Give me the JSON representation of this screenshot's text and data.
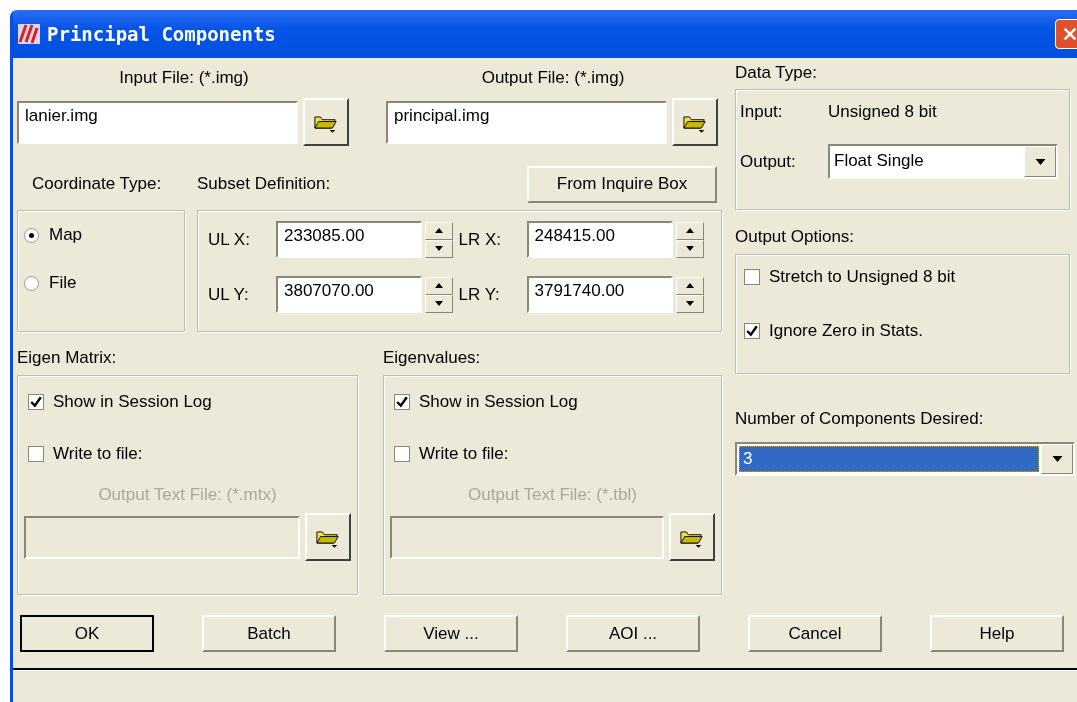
{
  "window": {
    "title": "Principal Components"
  },
  "input_file": {
    "label": "Input File: (*.img)",
    "value": "lanier.img"
  },
  "output_file": {
    "label": "Output File: (*.img)",
    "value": "principal.img"
  },
  "coordinate_type": {
    "label": "Coordinate Type:",
    "options": [
      {
        "label": "Map",
        "selected": true
      },
      {
        "label": "File",
        "selected": false
      }
    ]
  },
  "subset_definition": {
    "label": "Subset Definition:",
    "button": "From Inquire Box",
    "fields": [
      {
        "label": "UL X:",
        "value": "233085.00"
      },
      {
        "label": "LR X:",
        "value": "248415.00"
      },
      {
        "label": "UL Y:",
        "value": "3807070.00"
      },
      {
        "label": "LR Y:",
        "value": "3791740.00"
      }
    ]
  },
  "eigen_matrix": {
    "label": "Eigen Matrix:",
    "options": [
      {
        "label": "Show in Session Log",
        "checked": true
      },
      {
        "label": "Write to file:",
        "checked": false
      }
    ],
    "file_label": "Output Text File: (*.mtx)",
    "disabled": true
  },
  "eigenvalues": {
    "label": "Eigenvalues:",
    "options": [
      {
        "label": "Show in Session Log",
        "checked": true
      },
      {
        "label": "Write to file:",
        "checked": false
      }
    ],
    "file_label": "Output Text File: (*.tbl)",
    "disabled": true
  },
  "data_type": {
    "label": "Data Type:",
    "input_label": "Input:",
    "input_value": "Unsigned 8 bit",
    "output_label": "Output:",
    "output_value": "Float Single"
  },
  "output_options": {
    "label": "Output Options:",
    "options": [
      {
        "label": "Stretch to Unsigned 8 bit",
        "checked": false
      },
      {
        "label": "Ignore Zero in Stats.",
        "checked": true
      }
    ]
  },
  "components": {
    "label": "Number of Components Desired:",
    "value": "3",
    "focused": true
  },
  "buttons": [
    {
      "label": "OK",
      "default": true
    },
    {
      "label": "Batch",
      "default": false
    },
    {
      "label": "View ...",
      "default": false
    },
    {
      "label": "AOI ...",
      "default": false
    },
    {
      "label": "Cancel",
      "default": false
    },
    {
      "label": "Help",
      "default": false
    }
  ]
}
